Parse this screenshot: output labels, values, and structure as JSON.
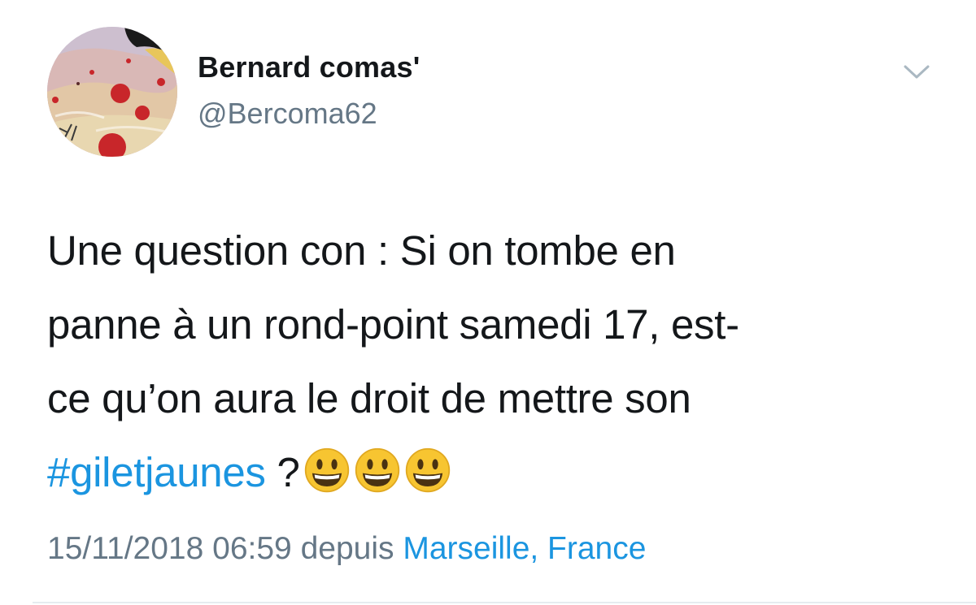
{
  "tweet": {
    "author": {
      "display_name": "Bernard comas'",
      "handle": "@Bercoma62",
      "avatar": "painted-landscape-avatar"
    },
    "menu_icon": "chevron-down-icon",
    "text_lines": [
      "Une question con : Si on tombe en",
      "panne à un rond-point samedi 17, est-",
      "ce qu’on aura le droit de mettre son"
    ],
    "hashtag": "#giletjaunes",
    "text_tail": " ?",
    "emojis": [
      "grinning-face-icon",
      "grinning-face-icon",
      "grinning-face-icon"
    ],
    "timestamp": "15/11/2018 06:59",
    "from_label": " depuis ",
    "location": "Marseille, France",
    "colors": {
      "link": "#1b95e0",
      "secondary_text": "#657786",
      "primary_text": "#14171a"
    }
  }
}
